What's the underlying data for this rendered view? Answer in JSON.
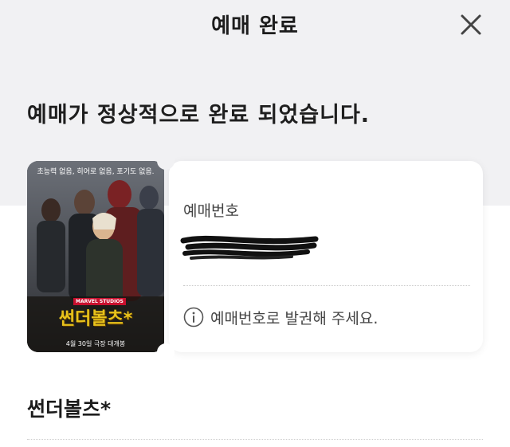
{
  "header": {
    "title": "예매 완료",
    "close_icon": "close-icon"
  },
  "message": "예매가 정상적으로 완료 되었습니다.",
  "ticket": {
    "booking_label": "예매번호",
    "booking_number": "",
    "notice_icon": "info-circle-icon",
    "notice": "예매번호로 발권해 주세요.",
    "poster": {
      "tagline": "초능력 없음, 히어로 없음, 포기도 없음.",
      "studio": "MARVEL STUDIOS",
      "title": "썬더볼츠*",
      "date": "4월 30일 극장 대개봉"
    }
  },
  "movie_title": "썬더볼츠*",
  "colors": {
    "background_gray": "#f1f1f3",
    "card": "#ffffff",
    "text_primary": "#1c1c1c",
    "text_secondary": "#444444",
    "poster_title": "#e8c21b"
  }
}
